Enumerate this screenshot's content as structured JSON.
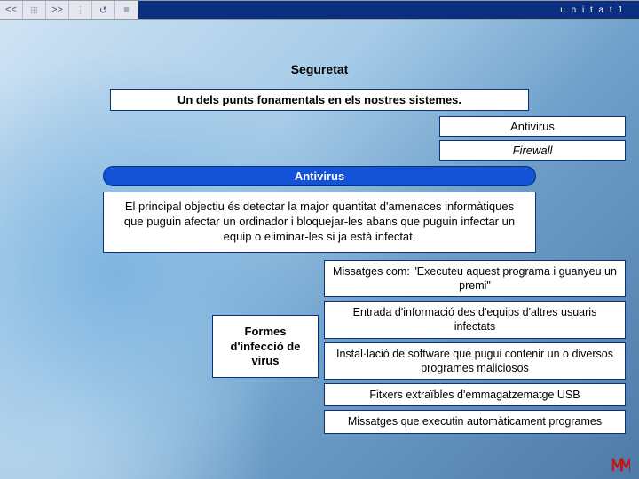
{
  "topbar": {
    "buttons": {
      "prev": "<<",
      "grid": "⊞",
      "next": ">>",
      "list": "⋮",
      "reload": "↺",
      "stop": "■"
    },
    "unit_label": "u n i t a t  1"
  },
  "title": "Seguretat",
  "subtitle": "Un dels punts fonamentals en els nostres sistemes.",
  "right_items": {
    "antivirus": "Antivirus",
    "firewall": "Firewall"
  },
  "section_header": "Antivirus",
  "description": "El principal objectiu és detectar la major quantitat d'amenaces informàtiques que puguin afectar un ordinador i bloquejar-les abans que puguin infectar un equip o eliminar-les si ja està infectat.",
  "infection_label": "Formes d'infecció de virus",
  "methods": [
    "Missatges com: \"Executeu aquest programa i guanyeu un premi\"",
    "Entrada d'informació des d'equips d'altres usuaris infectats",
    "Instal·lació de software que pugui contenir un o diversos programes maliciosos",
    "Fitxers extraïbles d'emmagatzematge USB",
    "Missatges que executin automàticament programes"
  ]
}
